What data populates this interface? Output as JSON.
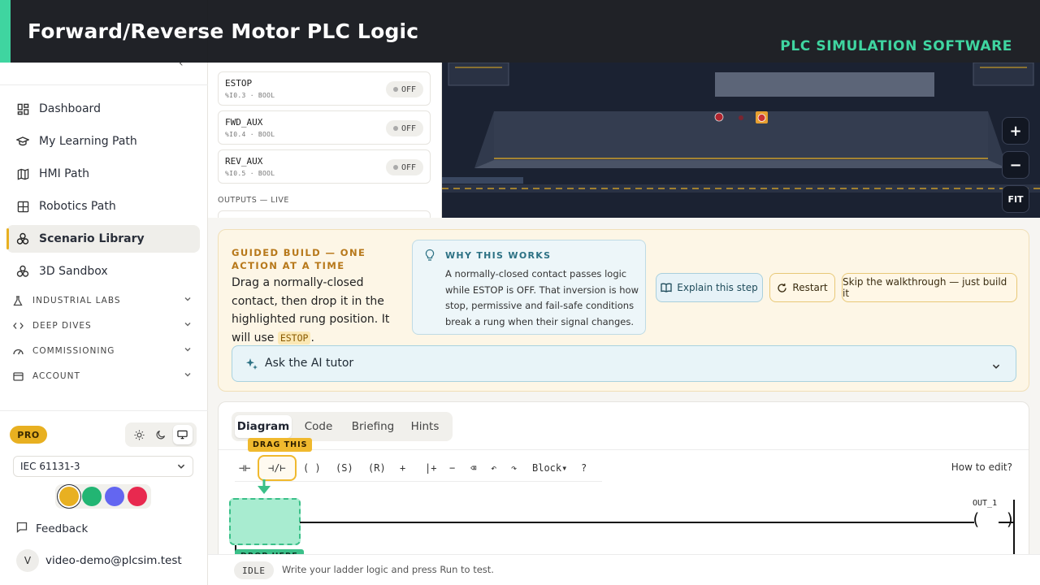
{
  "banner": {
    "title": "Forward/Reverse Motor PLC Logic",
    "subtitle": "PLC SIMULATION SOFTWARE"
  },
  "sidebar": {
    "collapse_icon": "‹",
    "nav": [
      {
        "label": "Dashboard",
        "icon": "dashboard-icon"
      },
      {
        "label": "My Learning Path",
        "icon": "graduation-cap-icon"
      },
      {
        "label": "HMI Path",
        "icon": "map-icon"
      },
      {
        "label": "Robotics Path",
        "icon": "robot-icon"
      },
      {
        "label": "Scenario Library",
        "icon": "library-icon",
        "active": true
      },
      {
        "label": "3D Sandbox",
        "icon": "cube-icon"
      }
    ],
    "sections": [
      {
        "label": "INDUSTRIAL LABS",
        "icon": "flask-icon"
      },
      {
        "label": "DEEP DIVES",
        "icon": "code-icon"
      },
      {
        "label": "COMMISSIONING",
        "icon": "gauge-icon"
      },
      {
        "label": "ACCOUNT",
        "icon": "card-icon"
      }
    ],
    "plan_badge": "PRO",
    "standard": "IEC 61131-3",
    "accent_colors": [
      "#e8b021",
      "#22b573",
      "#6366f1",
      "#e8294f"
    ],
    "feedback": "Feedback",
    "user": {
      "initial": "V",
      "email": "video-demo@plcsim.test"
    }
  },
  "io_panel": {
    "inputs": [
      {
        "name": "ESTOP",
        "addr": "%I0.3 · BOOL",
        "state": "OFF"
      },
      {
        "name": "FWD_AUX",
        "addr": "%I0.4 · BOOL",
        "state": "OFF"
      },
      {
        "name": "REV_AUX",
        "addr": "%I0.5 · BOOL",
        "state": "OFF"
      }
    ],
    "outputs_label": "OUTPUTS — LIVE"
  },
  "scene": {
    "zoom_in": "+",
    "zoom_out": "−",
    "fit": "FIT"
  },
  "guided": {
    "label": "GUIDED BUILD — ONE ACTION AT A TIME",
    "instruction": "Drag a normally-closed contact, then drop it in the highlighted rung position. It will use ",
    "tag": "ESTOP",
    "instruction_end": ".",
    "why_title": "WHY THIS WORKS",
    "why_body": "A normally-closed contact passes logic while ESTOP is OFF. That inversion is how stop, permissive and fail-safe conditions break a rung when their signal changes.",
    "explain_btn": "Explain this step",
    "restart_btn": "Restart",
    "skip_btn": "Skip the walkthrough — just build it",
    "tutor": "Ask the AI tutor"
  },
  "editor": {
    "tabs": [
      "Diagram",
      "Code",
      "Briefing",
      "Hints"
    ],
    "active_tab": "Diagram",
    "palette": [
      "⊣⊢",
      "⊣/⊢",
      "( )",
      "(S)",
      "(R)",
      "+",
      "|+",
      "−",
      "⌫",
      "↶",
      "↷",
      "Block▾",
      "?"
    ],
    "drag_hint": "DRAG THIS",
    "drop_hint": "DROP HERE",
    "how_to_edit": "How to edit?",
    "coil_label": "OUT_1",
    "coil_symbol": "( )"
  },
  "status": {
    "state": "IDLE",
    "message": "Write your ladder logic and press Run to test."
  }
}
